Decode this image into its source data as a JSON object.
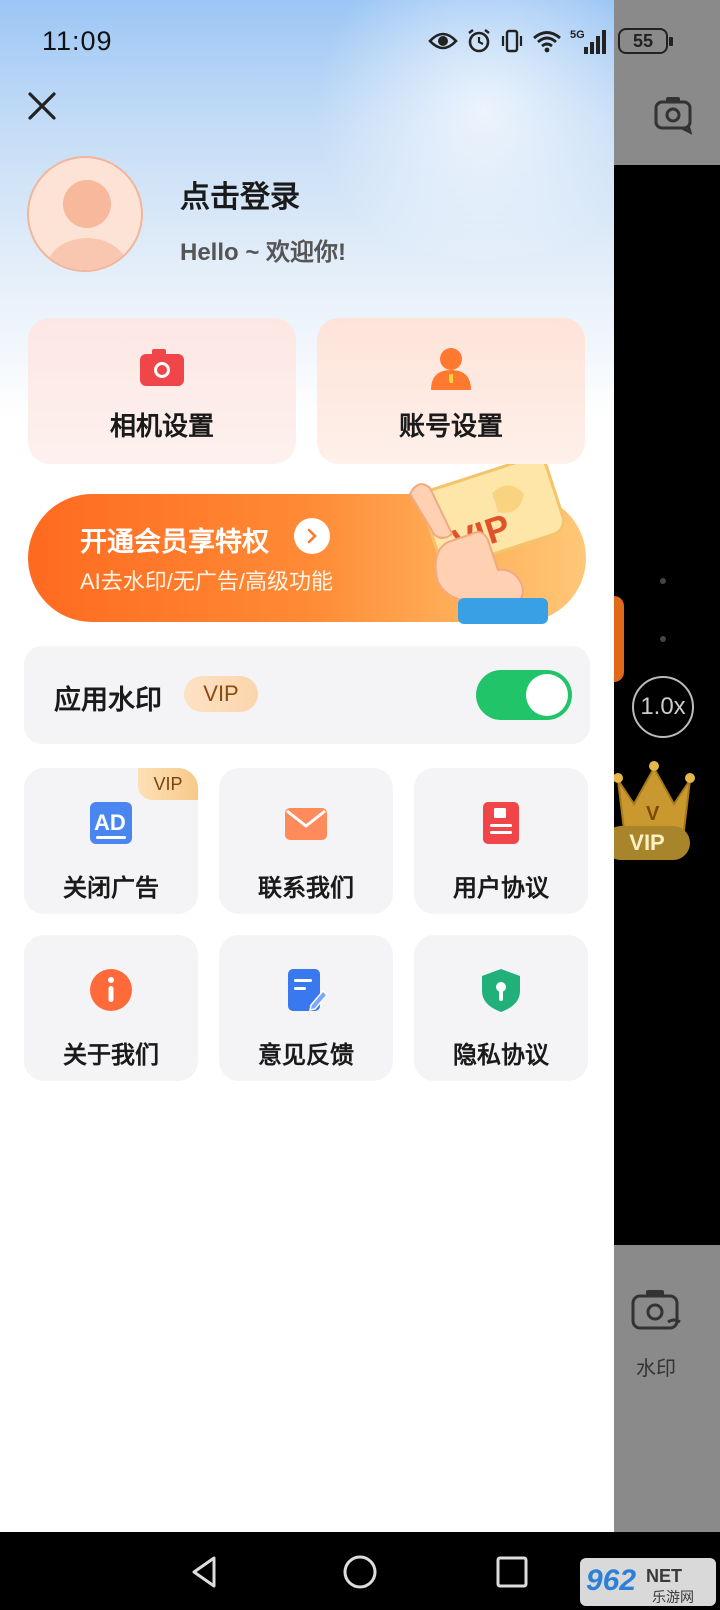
{
  "status_bar": {
    "time": "11:09",
    "battery": "55",
    "network": "5G"
  },
  "header": {
    "login_title": "点击登录",
    "login_subtitle": "Hello ~ 欢迎你!"
  },
  "settings": [
    {
      "label": "相机设置",
      "icon": "camera-icon",
      "color": "#f0464a"
    },
    {
      "label": "账号设置",
      "icon": "person-icon",
      "color": "#ff7a30"
    }
  ],
  "vip_banner": {
    "title": "开通会员享特权",
    "subtitle": "AI去水印/无广告/高级功能",
    "badge": "VIP"
  },
  "watermark": {
    "label": "应用水印",
    "badge": "VIP",
    "enabled": true
  },
  "grid": [
    {
      "label": "关闭广告",
      "icon": "ad-icon",
      "badge": "VIP"
    },
    {
      "label": "联系我们",
      "icon": "mail-icon"
    },
    {
      "label": "用户协议",
      "icon": "document-icon"
    },
    {
      "label": "关于我们",
      "icon": "info-icon"
    },
    {
      "label": "意见反馈",
      "icon": "feedback-icon"
    },
    {
      "label": "隐私协议",
      "icon": "shield-icon"
    }
  ],
  "background_app": {
    "zoom": "1.0x",
    "vip": "VIP",
    "watermark_label": "水印"
  },
  "site_logo": {
    "brand": "962",
    "suffix": "NET",
    "name": "乐游网"
  }
}
